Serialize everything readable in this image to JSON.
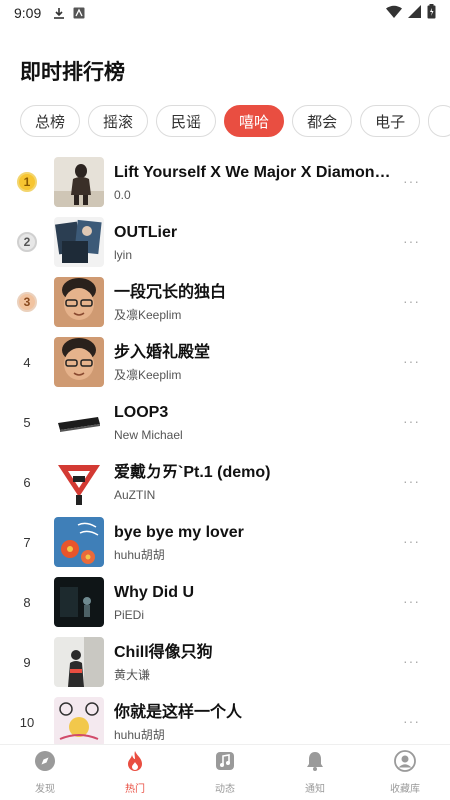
{
  "status": {
    "time": "9:09"
  },
  "title": "即时排行榜",
  "tabs": [
    {
      "label": "总榜"
    },
    {
      "label": "摇滚"
    },
    {
      "label": "民谣"
    },
    {
      "label": "嘻哈",
      "active": true
    },
    {
      "label": "都会"
    },
    {
      "label": "电子"
    },
    {
      "label": ""
    }
  ],
  "songs": [
    {
      "rank": "1",
      "title": "Lift Yourself X We Major X Diamonds...",
      "artist": "0.0"
    },
    {
      "rank": "2",
      "title": "OUTLier",
      "artist": "lyin"
    },
    {
      "rank": "3",
      "title": "一段冗长的独白",
      "artist": "及凛Keeplim"
    },
    {
      "rank": "4",
      "title": "步入婚礼殿堂",
      "artist": "及凛Keeplim"
    },
    {
      "rank": "5",
      "title": "LOOP3",
      "artist": "New Michael"
    },
    {
      "rank": "6",
      "title": "爱戴ㄉㄞ`Pt.1 (demo)",
      "artist": "AuZTIN"
    },
    {
      "rank": "7",
      "title": "bye bye my lover",
      "artist": "huhu胡胡"
    },
    {
      "rank": "8",
      "title": "Why Did U",
      "artist": "PiEDi"
    },
    {
      "rank": "9",
      "title": "Chill得像只狗",
      "artist": "黄大谦"
    },
    {
      "rank": "10",
      "title": "你就是这样一个人",
      "artist": "huhu胡胡"
    }
  ],
  "nav": [
    {
      "label": "发现",
      "icon": "compass-icon"
    },
    {
      "label": "热门",
      "icon": "flame-icon",
      "active": true
    },
    {
      "label": "动态",
      "icon": "music-note-icon"
    },
    {
      "label": "通知",
      "icon": "bell-icon"
    },
    {
      "label": "收藏库",
      "icon": "user-icon"
    }
  ],
  "colors": {
    "accent": "#e94e41",
    "gold": "#f7c531",
    "silver": "#e7e7e7",
    "bronze": "#f1c3a0"
  }
}
